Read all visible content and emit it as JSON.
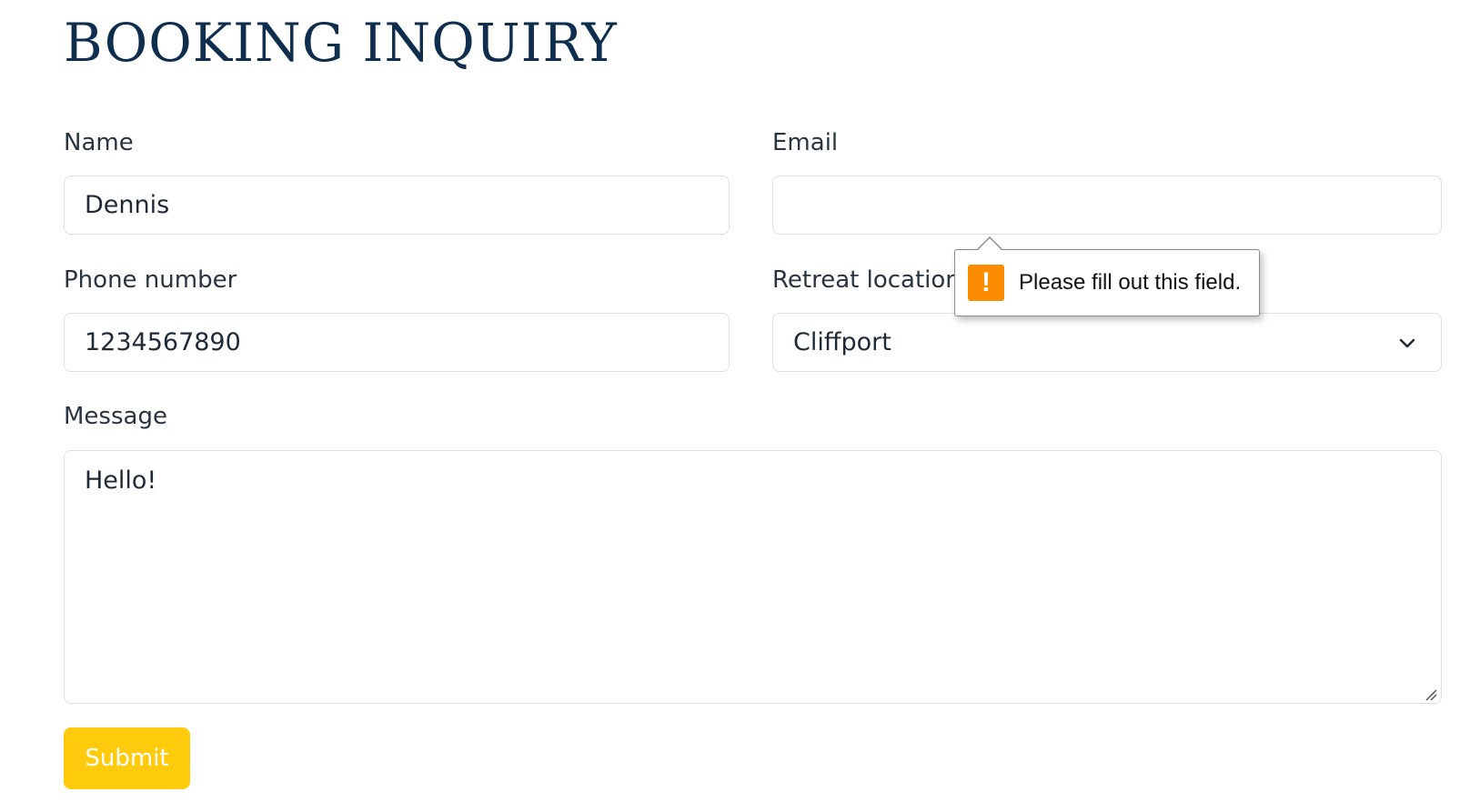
{
  "page": {
    "title": "BOOKING INQUIRY"
  },
  "form": {
    "name": {
      "label": "Name",
      "value": "Dennis"
    },
    "email": {
      "label": "Email",
      "value": ""
    },
    "phone": {
      "label": "Phone number",
      "value": "1234567890"
    },
    "location": {
      "label": "Retreat location",
      "value": "Cliffport"
    },
    "message": {
      "label": "Message",
      "value": "Hello!"
    },
    "submit_label": "Submit"
  },
  "validation_tooltip": {
    "icon": "warning-icon",
    "icon_glyph": "!",
    "text": "Please fill out this field."
  },
  "colors": {
    "title": "#0f2d4d",
    "submit_button": "#ffcb0c",
    "warning": "#fb8c00"
  }
}
